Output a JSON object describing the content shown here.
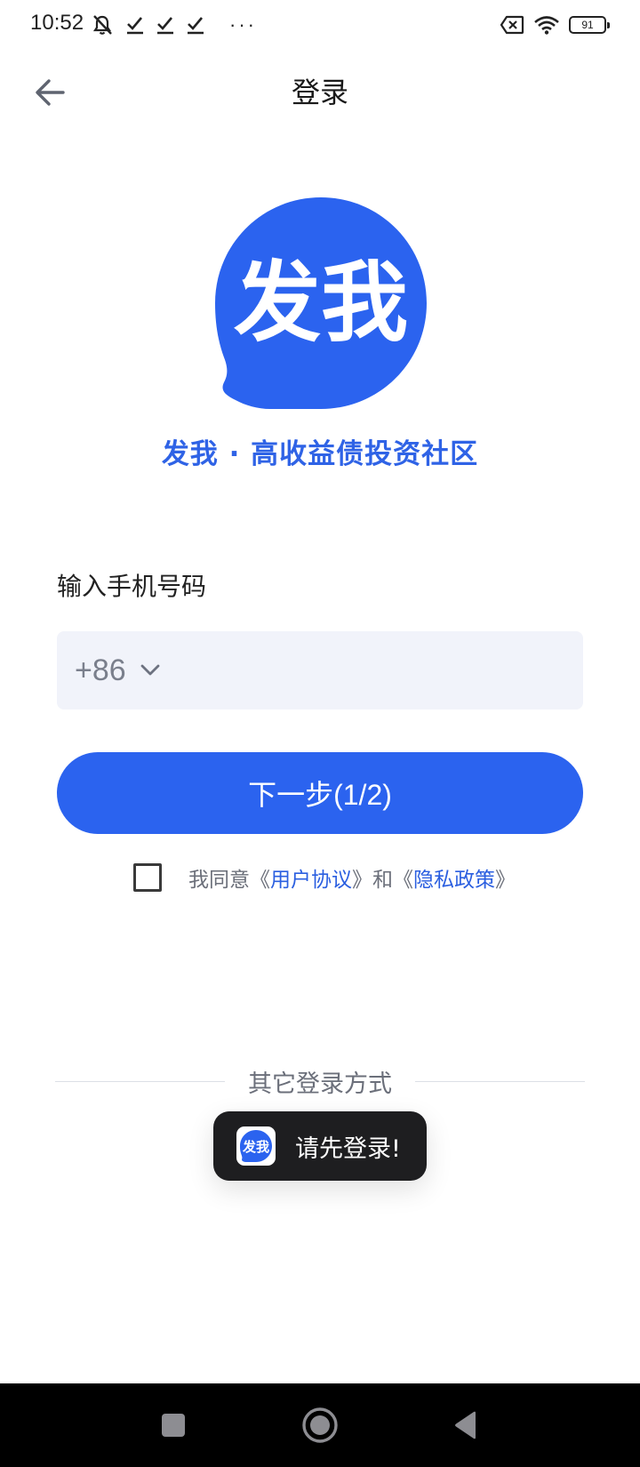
{
  "status_bar": {
    "time": "10:52",
    "left_icons": [
      "mute-bell-icon",
      "checkmark-icon",
      "checkmark-icon",
      "checkmark-icon"
    ],
    "dots": "···",
    "right_icons": [
      "sim-x-icon",
      "wifi-icon",
      "battery-icon"
    ],
    "battery_level": "91"
  },
  "header": {
    "title": "登录",
    "back_icon": "arrow-left-icon"
  },
  "brand": {
    "logo_text": "发我",
    "slogan": "发我 · 高收益债投资社区",
    "color": "#2f63e6"
  },
  "form": {
    "phone_label": "输入手机号码",
    "country_code": "+86",
    "phone_value": "",
    "next_label": "下一步(1/2)",
    "agree": {
      "prefix": "我同意《",
      "user_agreement": "用户协议",
      "middle": "》和《",
      "privacy_policy": "隐私政策",
      "suffix": "》",
      "checked": false
    }
  },
  "other_login": {
    "label": "其它登录方式"
  },
  "toast": {
    "icon_text": "发我",
    "message": "请先登录!"
  },
  "colors": {
    "accent": "#2b63ef",
    "link": "#2b5fe0",
    "input_bg": "#f1f3fa"
  },
  "nav_bar": {
    "icons": [
      "recent-apps-icon",
      "home-icon",
      "back-triangle-icon"
    ]
  }
}
